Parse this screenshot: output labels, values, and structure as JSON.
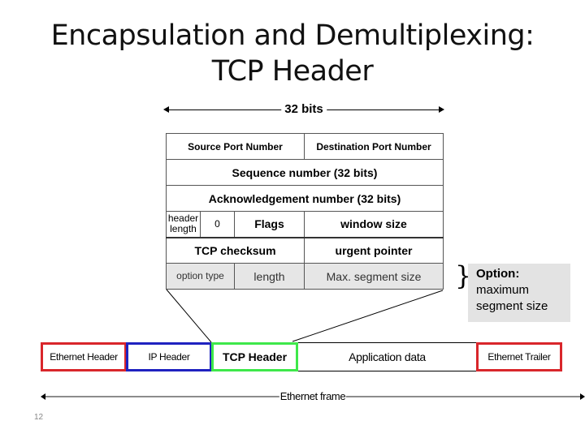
{
  "slide": {
    "title_line1": "Encapsulation and Demultiplexing:",
    "title_line2": "TCP Header",
    "slide_number": "12"
  },
  "tcp_header": {
    "width_label": "32 bits",
    "rows": [
      [
        "Source Port Number",
        "Destination Port Number"
      ],
      [
        "Sequence number (32 bits)"
      ],
      [
        "Acknowledgement number (32 bits)"
      ],
      [
        "header length",
        "0",
        "Flags",
        "window size"
      ],
      [
        "TCP checksum",
        "urgent pointer"
      ],
      [
        "option type",
        "length",
        "Max. segment size"
      ]
    ]
  },
  "callout": {
    "heading": "Option:",
    "line1": "maximum",
    "line2": "segment size",
    "brace": "}"
  },
  "ethernet_frame": {
    "segments": [
      {
        "label": "Ethernet Header",
        "color": "#d9262b"
      },
      {
        "label": "IP Header",
        "color": "#1f22c0"
      },
      {
        "label": "TCP Header",
        "color": "#3ee84a"
      },
      {
        "label": "Application data",
        "color": "#000000"
      },
      {
        "label": "Ethernet Trailer",
        "color": "#d9262b"
      }
    ],
    "span_label": "Ethernet frame"
  }
}
